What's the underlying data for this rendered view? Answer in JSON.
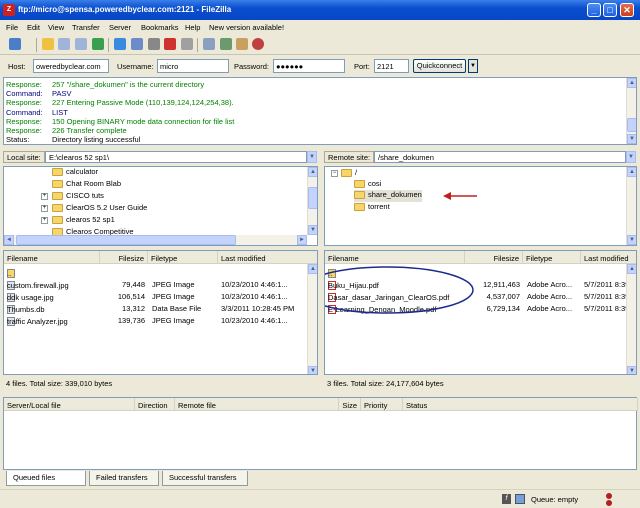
{
  "window": {
    "title": "ftp://micro@spensa.poweredbyclear.com:2121 - FileZilla"
  },
  "menu": [
    "File",
    "Edit",
    "View",
    "Transfer",
    "Server",
    "Bookmarks",
    "Help",
    "New version available!"
  ],
  "quickconnect": {
    "host_label": "Host:",
    "host_value": "oweredbyclear.com",
    "username_label": "Username:",
    "username_value": "micro",
    "password_label": "Password:",
    "password_value": "●●●●●●",
    "port_label": "Port:",
    "port_value": "2121",
    "button_label": "Quickconnect"
  },
  "log": [
    {
      "kind": "Response:",
      "text": "257 \"/share_dokumen\" is the current directory"
    },
    {
      "kind": "Command:",
      "text": "PASV"
    },
    {
      "kind": "Response:",
      "text": "227 Entering Passive Mode (110,139,124,124,254,38)."
    },
    {
      "kind": "Command:",
      "text": "LIST"
    },
    {
      "kind": "Response:",
      "text": "150 Opening BINARY mode data connection for file list"
    },
    {
      "kind": "Response:",
      "text": "226 Transfer complete"
    },
    {
      "kind": "Status:",
      "text": "Directory listing successful"
    }
  ],
  "colors": {
    "response": "#008000",
    "command": "#000080",
    "status": "#000000",
    "annotation": "#1c2a8c",
    "arrow": "#c02020"
  },
  "local": {
    "site_label": "Local site:",
    "path": "E:\\clearos 52 sp1\\",
    "tree": [
      "calculator",
      "Chat Room Blab",
      "CISCO tuts",
      "ClearOS 5.2 User Guide",
      "clearos 52 sp1",
      "Clearos Competitive"
    ],
    "columns": [
      "Filename",
      "Filesize",
      "Filetype",
      "Last modified"
    ],
    "files": [
      {
        "name": "..",
        "size": "",
        "type": "",
        "modified": ""
      },
      {
        "name": "custom.firewall.jpg",
        "size": "79,448",
        "type": "JPEG Image",
        "modified": "10/23/2010 4:46:1..."
      },
      {
        "name": "ddk usage.jpg",
        "size": "106,514",
        "type": "JPEG Image",
        "modified": "10/23/2010 4:46:1..."
      },
      {
        "name": "Thumbs.db",
        "size": "13,312",
        "type": "Data Base File",
        "modified": "3/3/2011 10:28:45 PM"
      },
      {
        "name": "traffic Analyzer.jpg",
        "size": "139,736",
        "type": "JPEG Image",
        "modified": "10/23/2010 4:46:1..."
      }
    ],
    "summary": "4 files. Total size: 339,010 bytes"
  },
  "remote": {
    "site_label": "Remote site:",
    "path": "/share_dokumen",
    "tree_root": "/",
    "tree": [
      "cosi",
      "share_dokumen",
      "torrent"
    ],
    "columns": [
      "Filename",
      "Filesize",
      "Filetype",
      "Last modified"
    ],
    "files": [
      {
        "name": "..",
        "size": "",
        "type": "",
        "modified": ""
      },
      {
        "name": "Buku_Hijau.pdf",
        "size": "12,911,463",
        "type": "Adobe Acro...",
        "modified": "5/7/2011 8:39"
      },
      {
        "name": "Dasar_dasar_Jaringan_ClearOS.pdf",
        "size": "4,537,007",
        "type": "Adobe Acro...",
        "modified": "5/7/2011 8:39"
      },
      {
        "name": "E-Learning_Dengan_Moodle.pdf",
        "size": "6,729,134",
        "type": "Adobe Acro...",
        "modified": "5/7/2011 8:39"
      }
    ],
    "summary": "3 files. Total size: 24,177,604 bytes"
  },
  "queue": {
    "columns": [
      "Server/Local file",
      "Direction",
      "Remote file",
      "Size",
      "Priority",
      "Status"
    ],
    "tabs": [
      "Queued files",
      "Failed transfers",
      "Successful transfers"
    ]
  },
  "statusbar": {
    "queue": "Queue: empty"
  }
}
